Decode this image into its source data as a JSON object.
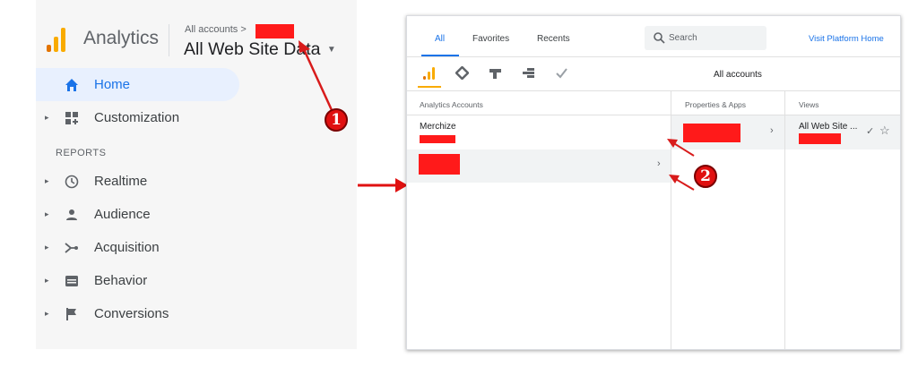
{
  "left_panel": {
    "app_title": "Analytics",
    "breadcrumb": "All accounts >",
    "view_selector": "All Web Site Data",
    "reports_header": "REPORTS",
    "nav": {
      "home": "Home",
      "customization": "Customization",
      "realtime": "Realtime",
      "audience": "Audience",
      "acquisition": "Acquisition",
      "behavior": "Behavior",
      "conversions": "Conversions"
    }
  },
  "popup": {
    "tabs": {
      "all": "All",
      "favorites": "Favorites",
      "recents": "Recents"
    },
    "search_placeholder": "Search",
    "visit_platform_home": "Visit Platform Home",
    "current_level": "All accounts",
    "columns": {
      "accounts": "Analytics Accounts",
      "properties": "Properties & Apps",
      "views": "Views"
    },
    "accounts": [
      {
        "name": "Merchize"
      }
    ],
    "views": [
      {
        "name": "All Web Site ..."
      }
    ]
  },
  "annotations": {
    "badge_1": "1",
    "badge_2": "2"
  },
  "colors": {
    "ga_orange": "#f9ab00",
    "accent_blue": "#1a73e8",
    "annotation_red": "#e01010"
  }
}
